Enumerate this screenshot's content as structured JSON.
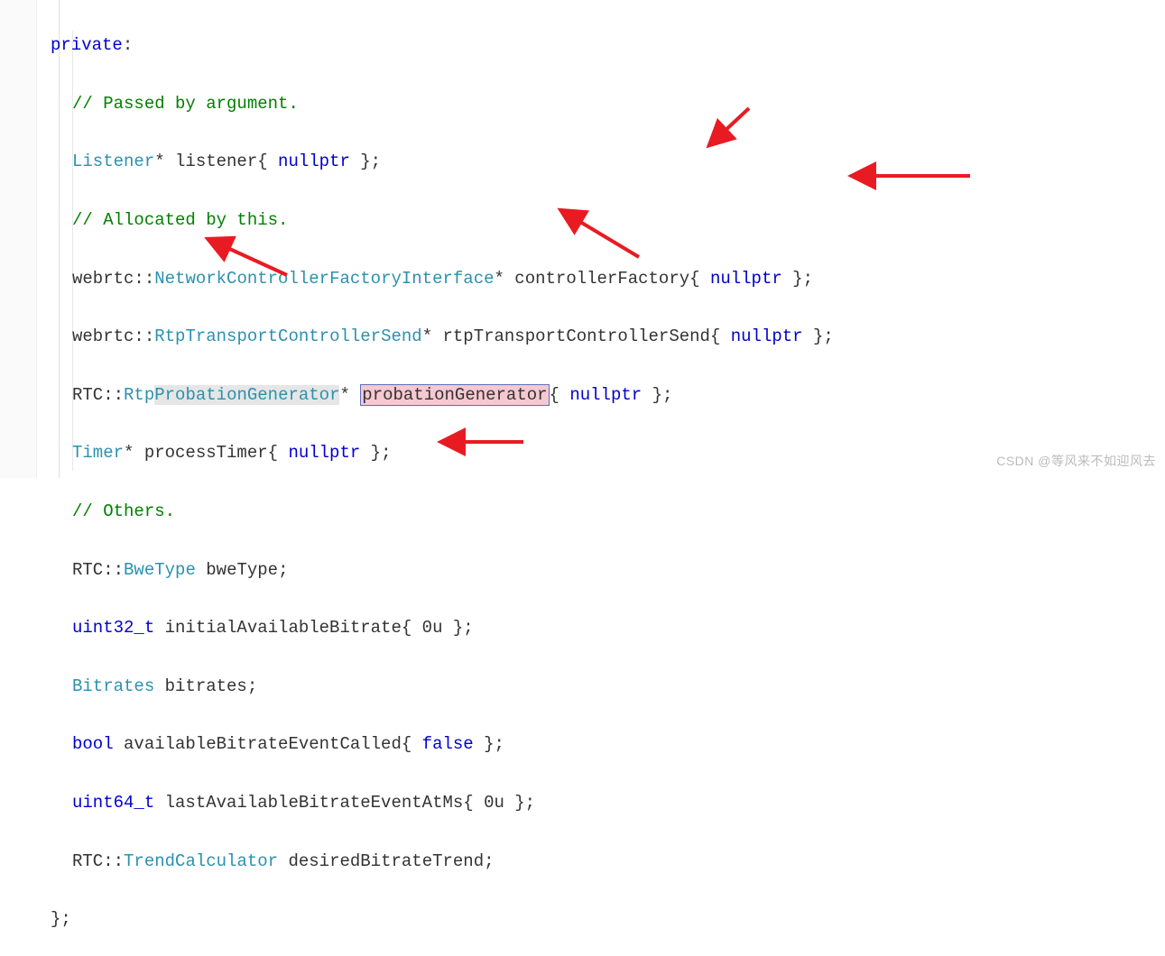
{
  "code": {
    "l1": {
      "kw": "private",
      "colon": ":"
    },
    "l2": {
      "comment": "// Passed by argument."
    },
    "l3": {
      "t1": "Listener",
      "rest": "* listener{ ",
      "null": "nullptr",
      "end": " };"
    },
    "l4": {
      "comment": "// Allocated by this."
    },
    "l5": {
      "ns": "webrtc",
      "sep": "::",
      "t": "NetworkControllerFactoryInterface",
      "rest": "* controllerFactory{ ",
      "null": "nullptr",
      "end": " };"
    },
    "l6": {
      "ns": "webrtc",
      "sep": "::",
      "t": "RtpTransportControllerSend",
      "rest": "* rtpTransportControllerSend{ ",
      "null": "nullptr",
      "end": " };"
    },
    "l7": {
      "ns": "RTC",
      "sep": "::",
      "t_pre": "Rtp",
      "t_hl": "ProbationGenerator",
      "star": "* ",
      "var_hl": "probationGenerator",
      "brace": "{ ",
      "null": "nullptr",
      "end": " };"
    },
    "l8": {
      "t": "Timer",
      "rest": "* processTimer{ ",
      "null": "nullptr",
      "end": " };"
    },
    "l9": {
      "comment": "// Others."
    },
    "l10": {
      "ns": "RTC",
      "sep": "::",
      "t": "BweType",
      "rest": " bweType;"
    },
    "l11": {
      "t": "uint32_t",
      "rest": " initialAvailableBitrate{ 0u };"
    },
    "l12": {
      "t": "Bitrates",
      "rest": " bitrates;"
    },
    "l13": {
      "t": "bool",
      "rest": " availableBitrateEventCalled{ ",
      "kw2": "false",
      "end": " };"
    },
    "l14": {
      "t": "uint64_t",
      "rest": " lastAvailableBitrateEventAtMs{ 0u };"
    },
    "l15": {
      "ns": "RTC",
      "sep": "::",
      "t": "TrendCalculator",
      "rest": " desiredBitrateTrend;"
    },
    "l16": {
      "text": "};"
    }
  },
  "watermark": "CSDN @等风来不如迎风去",
  "arrow_color": "#e81b23"
}
